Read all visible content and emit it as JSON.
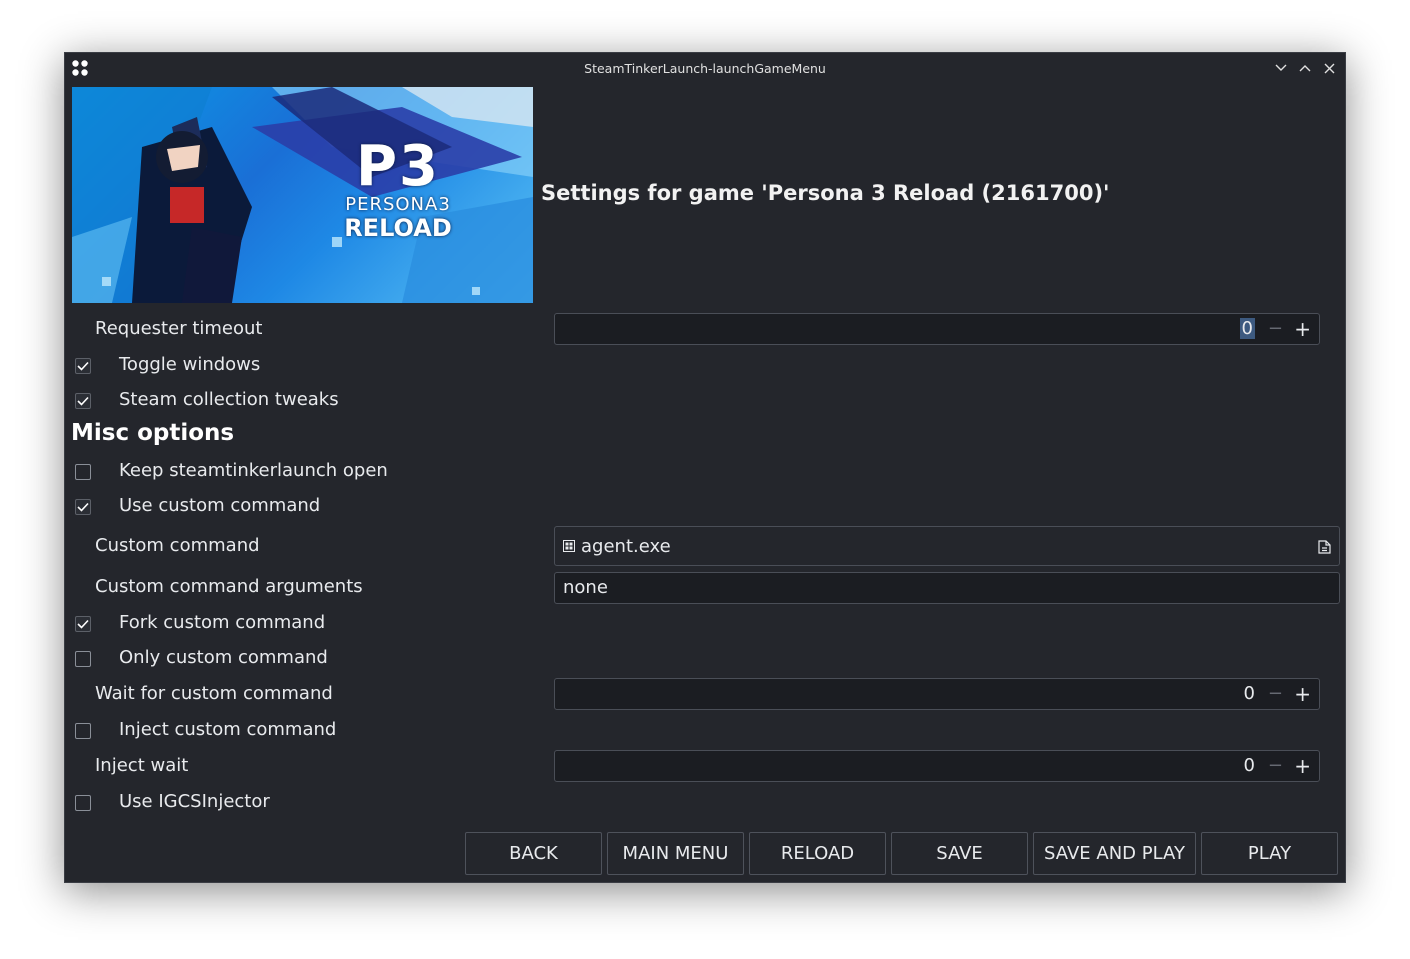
{
  "window": {
    "title": "SteamTinkerLaunch-launchGameMenu"
  },
  "banner": {
    "logo_main": "P3",
    "logo_sub": "PERSONA3",
    "logo_reload": "RELOAD"
  },
  "header": {
    "settings_title": "Settings for game 'Persona 3 Reload (2161700)'"
  },
  "options": {
    "requester_timeout": {
      "label": "Requester timeout",
      "value": "0"
    },
    "toggle_windows": {
      "label": "Toggle windows",
      "checked": true
    },
    "steam_collection_tweaks": {
      "label": "Steam collection tweaks",
      "checked": true
    },
    "misc_header": "Misc options",
    "keep_open": {
      "label": "Keep steamtinkerlaunch open",
      "checked": false
    },
    "use_custom_command": {
      "label": "Use custom command",
      "checked": true
    },
    "custom_command": {
      "label": "Custom command",
      "value": "agent.exe"
    },
    "custom_command_args": {
      "label": "Custom command arguments",
      "value": "none"
    },
    "fork_custom_command": {
      "label": "Fork custom command",
      "checked": true
    },
    "only_custom_command": {
      "label": "Only custom command",
      "checked": false
    },
    "wait_custom_command": {
      "label": "Wait for custom command",
      "value": "0"
    },
    "inject_custom_command": {
      "label": "Inject custom command",
      "checked": false
    },
    "inject_wait": {
      "label": "Inject wait",
      "value": "0"
    },
    "use_igcs": {
      "label": "Use IGCSInjector",
      "checked": false
    }
  },
  "spinner": {
    "minus": "−",
    "plus": "+"
  },
  "buttons": {
    "back": "BACK",
    "main_menu": "MAIN MENU",
    "reload": "RELOAD",
    "save": "SAVE",
    "save_and_play": "SAVE AND PLAY",
    "play": "PLAY"
  },
  "icons": {
    "app": "steamtinkerlaunch-icon",
    "minimize": "chevron-down-icon",
    "maximize": "chevron-up-icon",
    "close": "close-icon",
    "check": "check-icon",
    "file": "file-icon",
    "browse": "document-browse-icon"
  }
}
